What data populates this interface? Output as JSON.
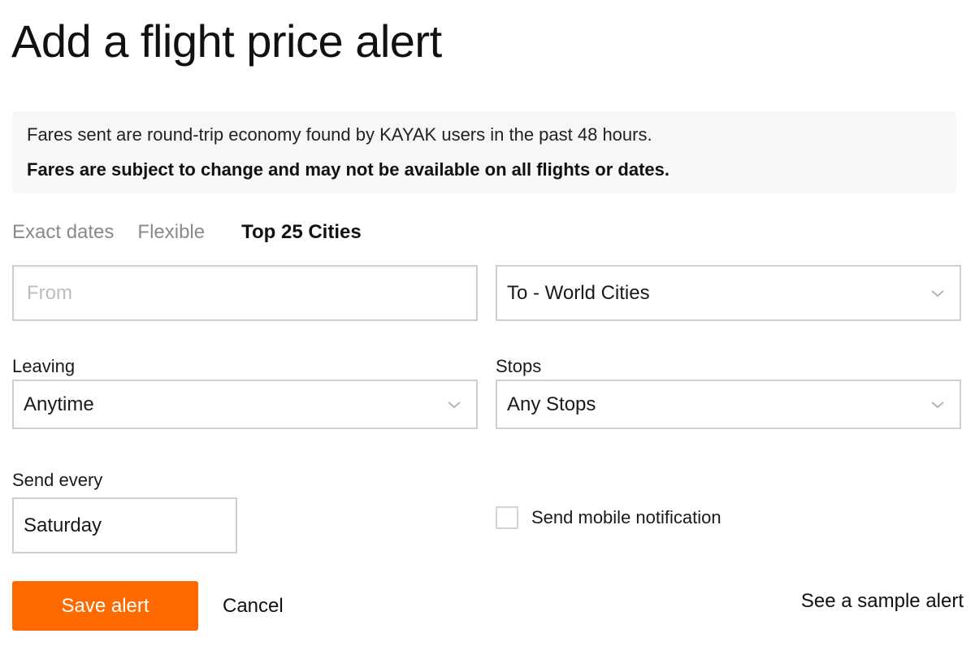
{
  "page": {
    "title": "Add a flight price alert"
  },
  "notice": {
    "line1": "Fares sent are round-trip economy found by KAYAK users in the past 48 hours.",
    "line2": "Fares are subject to change and may not be available on all flights or dates."
  },
  "tabs": [
    {
      "label": "Exact dates",
      "active": false
    },
    {
      "label": "Flexible",
      "active": false
    },
    {
      "label": "Top 25 Cities",
      "active": true
    }
  ],
  "form": {
    "from": {
      "placeholder": "From",
      "value": ""
    },
    "to": {
      "value": "To - World Cities"
    },
    "leaving": {
      "label": "Leaving",
      "value": "Anytime"
    },
    "stops": {
      "label": "Stops",
      "value": "Any Stops"
    },
    "send_every": {
      "label": "Send every",
      "value": "Saturday"
    },
    "mobile_notification": {
      "label": "Send mobile notification",
      "checked": false
    }
  },
  "actions": {
    "save_label": "Save alert",
    "cancel_label": "Cancel",
    "sample_label": "See a sample alert"
  },
  "colors": {
    "accent": "#ff6a00",
    "notice_bg": "#f7f7f7",
    "inactive_tab": "#8a8a8a"
  },
  "icons": {
    "dropdown": "chevron-down-icon"
  }
}
